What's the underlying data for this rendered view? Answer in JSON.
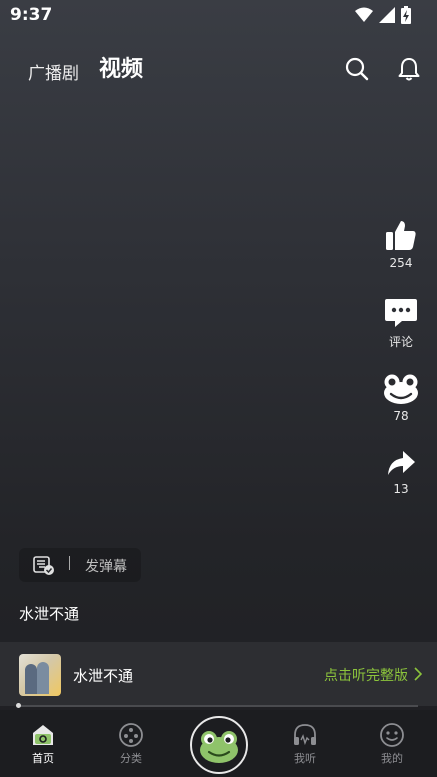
{
  "status_bar": {
    "time": "9:37"
  },
  "top_nav": {
    "tab_radio": "广播剧",
    "tab_video": "视频"
  },
  "side_actions": {
    "like_count": "254",
    "comment_label": "评论",
    "frog_count": "78",
    "share_count": "13"
  },
  "danmaku": {
    "label": "发弹幕"
  },
  "video_title": "水泄不通",
  "album": {
    "name": "水泄不通",
    "link": "点击听完整版"
  },
  "colors": {
    "accent": "#8cc43c",
    "frog": "#8fc36a",
    "nav_active": "#ffffff",
    "nav_inactive": "#8d8e92"
  },
  "bottom_nav": {
    "home": "首页",
    "category": "分类",
    "listening": "我听",
    "mine": "我的"
  }
}
